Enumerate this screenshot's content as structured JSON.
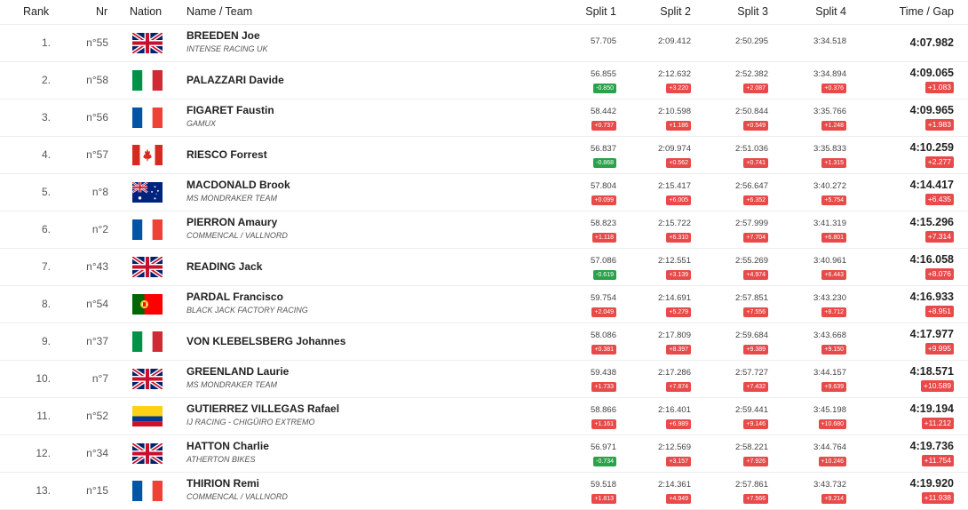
{
  "header": {
    "rank": "Rank",
    "nr": "Nr",
    "nation": "Nation",
    "name_team": "Name / Team",
    "split1": "Split 1",
    "split2": "Split 2",
    "split3": "Split 3",
    "split4": "Split 4",
    "time_gap": "Time / Gap"
  },
  "rows": [
    {
      "rank": "1.",
      "nr": "n°55",
      "flag": "gb",
      "name": "BREEDEN Joe",
      "team": "INTENSE RACING UK",
      "s1": "57.705",
      "s2": "2:09.412",
      "s3": "2:50.295",
      "s4": "3:34.518",
      "d1": "",
      "d2": "",
      "d3": "",
      "d4": "",
      "time": "4:07.982",
      "gap": ""
    },
    {
      "rank": "2.",
      "nr": "n°58",
      "flag": "it",
      "name": "PALAZZARI Davide",
      "team": "",
      "s1": "56.855",
      "s2": "2:12.632",
      "s3": "2:52.382",
      "s4": "3:34.894",
      "d1": "-0.850",
      "d2": "+3.220",
      "d3": "+2.087",
      "d4": "+0.376",
      "time": "4:09.065",
      "gap": "+1.083"
    },
    {
      "rank": "3.",
      "nr": "n°56",
      "flag": "fr",
      "name": "FIGARET Faustin",
      "team": "GAMUX",
      "s1": "58.442",
      "s2": "2:10.598",
      "s3": "2:50.844",
      "s4": "3:35.766",
      "d1": "+0.737",
      "d2": "+1.186",
      "d3": "+0.549",
      "d4": "+1.248",
      "time": "4:09.965",
      "gap": "+1.983"
    },
    {
      "rank": "4.",
      "nr": "n°57",
      "flag": "ca",
      "name": "RIESCO Forrest",
      "team": "",
      "s1": "56.837",
      "s2": "2:09.974",
      "s3": "2:51.036",
      "s4": "3:35.833",
      "d1": "-0.868",
      "d2": "+0.562",
      "d3": "+0.741",
      "d4": "+1.315",
      "time": "4:10.259",
      "gap": "+2.277"
    },
    {
      "rank": "5.",
      "nr": "n°8",
      "flag": "au",
      "name": "MACDONALD Brook",
      "team": "MS MONDRAKER TEAM",
      "s1": "57.804",
      "s2": "2:15.417",
      "s3": "2:56.647",
      "s4": "3:40.272",
      "d1": "+0.099",
      "d2": "+6.005",
      "d3": "+6.352",
      "d4": "+5.754",
      "time": "4:14.417",
      "gap": "+6.435"
    },
    {
      "rank": "6.",
      "nr": "n°2",
      "flag": "fr",
      "name": "PIERRON Amaury",
      "team": "COMMENCAL / VALLNORD",
      "s1": "58.823",
      "s2": "2:15.722",
      "s3": "2:57.999",
      "s4": "3:41.319",
      "d1": "+1.118",
      "d2": "+6.310",
      "d3": "+7.704",
      "d4": "+6.801",
      "time": "4:15.296",
      "gap": "+7.314"
    },
    {
      "rank": "7.",
      "nr": "n°43",
      "flag": "gb",
      "name": "READING Jack",
      "team": "",
      "s1": "57.086",
      "s2": "2:12.551",
      "s3": "2:55.269",
      "s4": "3:40.961",
      "d1": "-0.619",
      "d2": "+3.139",
      "d3": "+4.974",
      "d4": "+6.443",
      "time": "4:16.058",
      "gap": "+8.076"
    },
    {
      "rank": "8.",
      "nr": "n°54",
      "flag": "pt",
      "name": "PARDAL Francisco",
      "team": "BLACK JACK FACTORY RACING",
      "s1": "59.754",
      "s2": "2:14.691",
      "s3": "2:57.851",
      "s4": "3:43.230",
      "d1": "+2.049",
      "d2": "+5.279",
      "d3": "+7.556",
      "d4": "+8.712",
      "time": "4:16.933",
      "gap": "+8.951"
    },
    {
      "rank": "9.",
      "nr": "n°37",
      "flag": "it",
      "name": "VON KLEBELSBERG Johannes",
      "team": "",
      "s1": "58.086",
      "s2": "2:17.809",
      "s3": "2:59.684",
      "s4": "3:43.668",
      "d1": "+0.381",
      "d2": "+8.397",
      "d3": "+9.389",
      "d4": "+9.150",
      "time": "4:17.977",
      "gap": "+9.995"
    },
    {
      "rank": "10.",
      "nr": "n°7",
      "flag": "gb",
      "name": "GREENLAND Laurie",
      "team": "MS MONDRAKER TEAM",
      "s1": "59.438",
      "s2": "2:17.286",
      "s3": "2:57.727",
      "s4": "3:44.157",
      "d1": "+1.733",
      "d2": "+7.874",
      "d3": "+7.432",
      "d4": "+9.639",
      "time": "4:18.571",
      "gap": "+10.589"
    },
    {
      "rank": "11.",
      "nr": "n°52",
      "flag": "co",
      "name": "GUTIERREZ VILLEGAS Rafael",
      "team": "IJ RACING - CHIGÜIRO EXTREMO",
      "s1": "58.866",
      "s2": "2:16.401",
      "s3": "2:59.441",
      "s4": "3:45.198",
      "d1": "+1.161",
      "d2": "+6.989",
      "d3": "+9.146",
      "d4": "+10.680",
      "time": "4:19.194",
      "gap": "+11.212"
    },
    {
      "rank": "12.",
      "nr": "n°34",
      "flag": "gb",
      "name": "HATTON Charlie",
      "team": "ATHERTON BIKES",
      "s1": "56.971",
      "s2": "2:12.569",
      "s3": "2:58.221",
      "s4": "3:44.764",
      "d1": "-0.734",
      "d2": "+3.157",
      "d3": "+7.926",
      "d4": "+10.246",
      "time": "4:19.736",
      "gap": "+11.754"
    },
    {
      "rank": "13.",
      "nr": "n°15",
      "flag": "fr",
      "name": "THIRION Remi",
      "team": "COMMENCAL / VALLNORD",
      "s1": "59.518",
      "s2": "2:14.361",
      "s3": "2:57.861",
      "s4": "3:43.732",
      "d1": "+1.813",
      "d2": "+4.949",
      "d3": "+7.566",
      "d4": "+9.214",
      "time": "4:19.920",
      "gap": "+11.938"
    }
  ],
  "colors": {
    "positive": "#e84a4a",
    "negative": "#2aa24a"
  }
}
